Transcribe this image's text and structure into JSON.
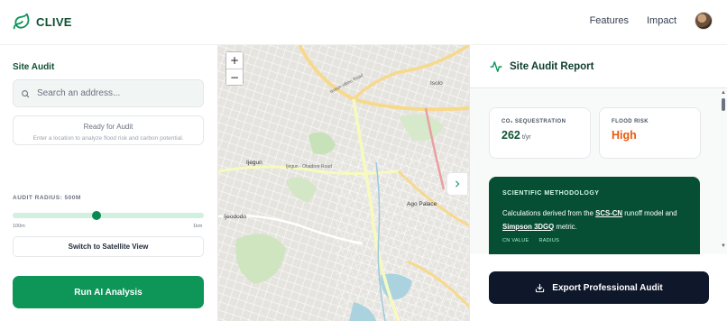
{
  "header": {
    "brand": "CLIVE",
    "nav": [
      "Features",
      "Impact"
    ]
  },
  "left_panel": {
    "title": "Site Audit",
    "search_placeholder": "Search an address...",
    "status_title": "Ready for Audit",
    "status_subtitle": "Enter a location to analyze flood risk and carbon potential.",
    "radius_label": "AUDIT RADIUS: 500M",
    "radius_min": "100m",
    "radius_max": "1km",
    "radius_fraction": 0.44,
    "satellite_button": "Switch to Satellite View",
    "run_button": "Run AI Analysis"
  },
  "map": {
    "zoom_in": "+",
    "zoom_out": "−",
    "labels": [
      "Ijegun",
      "Ijeododo",
      "Ago Palace",
      "Isolo",
      "Ikotun-Idimu Road",
      "Ijegun - Obadore Road"
    ],
    "panel_toggle": "›"
  },
  "report": {
    "title": "Site Audit Report",
    "co2_label": "CO₂ SEQUESTRATION",
    "co2_value": "262",
    "co2_unit": "t/yr",
    "flood_label": "FLOOD RISK",
    "flood_value": "High",
    "methodology_title": "SCIENTIFIC METHODOLOGY",
    "methodology_pre": "Calculations derived from the ",
    "methodology_link1": "SCS-CN",
    "methodology_mid": " runoff model and ",
    "methodology_link2": "Simpson 3DGQ",
    "methodology_post": " metric.",
    "cn_label": "CN VALUE",
    "radius_key": "RADIUS",
    "export_button": "Export Professional Audit"
  },
  "colors": {
    "brand": "#0d9658",
    "dark_green": "#064e34",
    "flood_high": "#ea580c",
    "co2_value": "#0f5132",
    "export_bg": "#0f172a"
  }
}
